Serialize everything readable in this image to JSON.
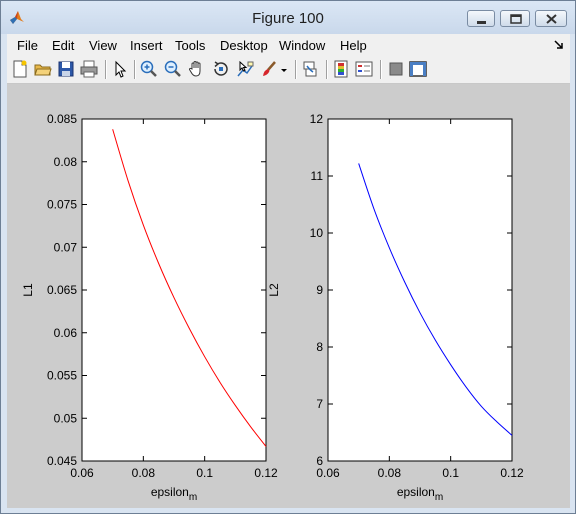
{
  "window": {
    "title": "Figure 100"
  },
  "menu": [
    "File",
    "Edit",
    "View",
    "Insert",
    "Tools",
    "Desktop",
    "Window",
    "Help"
  ],
  "toolbar": [
    "new-figure-icon",
    "open-file-icon",
    "save-icon",
    "print-icon",
    "edit-plot-arrow-icon",
    "zoom-in-icon",
    "zoom-out-icon",
    "pan-hand-icon",
    "rotate-3d-icon",
    "data-cursor-icon",
    "brush-icon",
    "brush-dropdown-icon",
    "link-plot-icon",
    "insert-colorbar-icon",
    "insert-legend-icon",
    "hide-plot-tools-icon",
    "show-plot-tools-icon"
  ],
  "chart_data": [
    {
      "type": "line",
      "xlabel": "epsilon",
      "xlabel_subscript": "m",
      "ylabel": "L1",
      "xlim": [
        0.06,
        0.12
      ],
      "ylim": [
        0.045,
        0.085
      ],
      "xticks": [
        "0.06",
        "0.08",
        "0.1",
        "0.12"
      ],
      "yticks": [
        "0.045",
        "0.05",
        "0.055",
        "0.06",
        "0.065",
        "0.07",
        "0.075",
        "0.08",
        "0.085"
      ],
      "line_color": "#ff0000",
      "series": [
        {
          "x": [
            0.07,
            0.075,
            0.08,
            0.085,
            0.09,
            0.095,
            0.1,
            0.105,
            0.11,
            0.115,
            0.12
          ],
          "y": [
            0.0838,
            0.0778,
            0.0726,
            0.0681,
            0.0641,
            0.0605,
            0.0572,
            0.0542,
            0.0515,
            0.049,
            0.0467
          ]
        }
      ]
    },
    {
      "type": "line",
      "xlabel": "epsilon",
      "xlabel_subscript": "m",
      "ylabel": "L2",
      "xlim": [
        0.06,
        0.12
      ],
      "ylim": [
        6,
        12
      ],
      "xticks": [
        "0.06",
        "0.08",
        "0.1",
        "0.12"
      ],
      "yticks": [
        "6",
        "7",
        "8",
        "9",
        "10",
        "11",
        "12"
      ],
      "line_color": "#0000ff",
      "series": [
        {
          "x": [
            0.07,
            0.075,
            0.08,
            0.085,
            0.09,
            0.095,
            0.1,
            0.105,
            0.11,
            0.115,
            0.12
          ],
          "y": [
            11.22,
            10.42,
            9.74,
            9.14,
            8.6,
            8.12,
            7.69,
            7.3,
            6.96,
            6.69,
            6.45
          ]
        }
      ]
    }
  ]
}
